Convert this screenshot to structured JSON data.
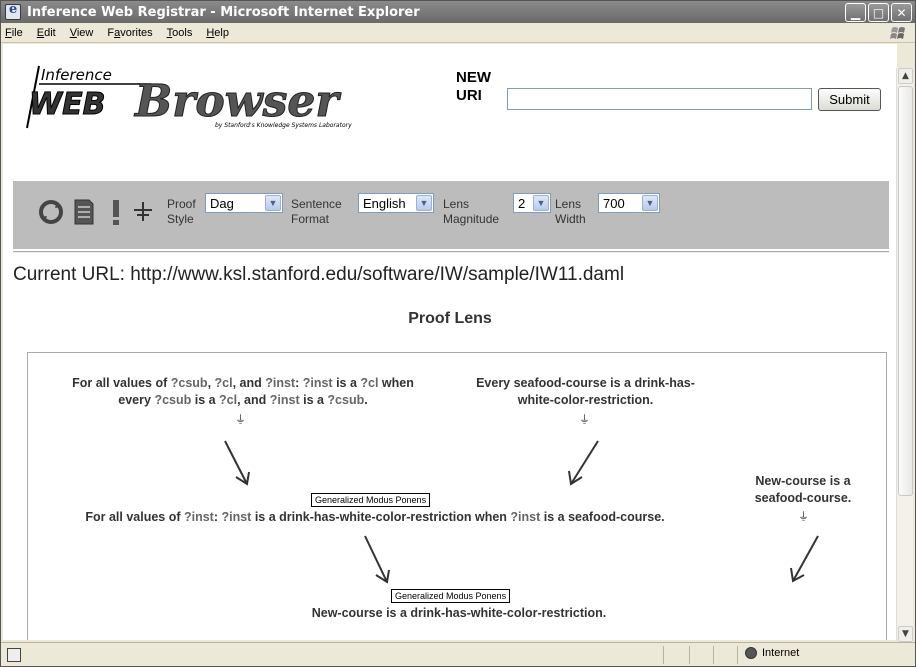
{
  "window": {
    "title": "Inference Web Registrar - Microsoft Internet Explorer",
    "buttons": [
      "minimize",
      "maximize",
      "close"
    ]
  },
  "menu": [
    {
      "label": "File",
      "ul": "F",
      "rest": "ile"
    },
    {
      "label": "Edit",
      "ul": "E",
      "rest": "dit"
    },
    {
      "label": "View",
      "ul": "V",
      "rest": "iew"
    },
    {
      "label": "Favorites",
      "ul": "a",
      "pre": "F",
      "rest": "vorites"
    },
    {
      "label": "Tools",
      "ul": "T",
      "rest": "ools"
    },
    {
      "label": "Help",
      "ul": "H",
      "rest": "elp"
    }
  ],
  "logo": {
    "top": "Inference",
    "main1": "WEB",
    "main2": "Browser",
    "byline": "by Stanford's Knowledge Systems Laboratory"
  },
  "new_uri": {
    "label_line1": "NEW",
    "label_line2": "URI",
    "value": "",
    "submit_label": "Submit"
  },
  "toolbar": {
    "proof_style": {
      "label1": "Proof",
      "label2": "Style",
      "value": "Dag"
    },
    "sentence_format": {
      "label1": "Sentence",
      "label2": "Format",
      "value": "English"
    },
    "lens_magnitude": {
      "label1": "Lens",
      "label2": "Magnitude",
      "value": "2"
    },
    "lens_width": {
      "label1": "Lens",
      "label2": "Width",
      "value": "700"
    }
  },
  "current_url": "Current URL: http://www.ksl.stanford.edu/software/IW/sample/IW11.daml",
  "lens_title": "Proof Lens",
  "proof": {
    "premise1": {
      "line1": [
        "For all values of ",
        "?csub",
        ", ",
        "?cl",
        ", and ",
        "?inst",
        ": ",
        "?inst",
        " is a ",
        "?cl",
        " when"
      ],
      "line2": [
        "every ",
        "?csub",
        " is a ",
        "?cl",
        ", and ",
        "?inst",
        " is a ",
        "?csub",
        "."
      ]
    },
    "premise2": {
      "line1": "Every seafood-course is a drink-has-",
      "line2": "white-color-restriction."
    },
    "premise3": {
      "line1": "New-course is a",
      "line2": "seafood-course."
    },
    "intermediate": [
      "For all values of ",
      "?inst",
      ": ",
      "?inst",
      " is a drink-has-white-color-restriction when ",
      "?inst",
      " is a seafood-course."
    ],
    "conclusion": "New-course is a drink-has-white-color-restriction.",
    "rule1": "Generalized Modus Ponens",
    "rule2": "Generalized Modus Ponens"
  },
  "status": {
    "zone": "Internet"
  }
}
